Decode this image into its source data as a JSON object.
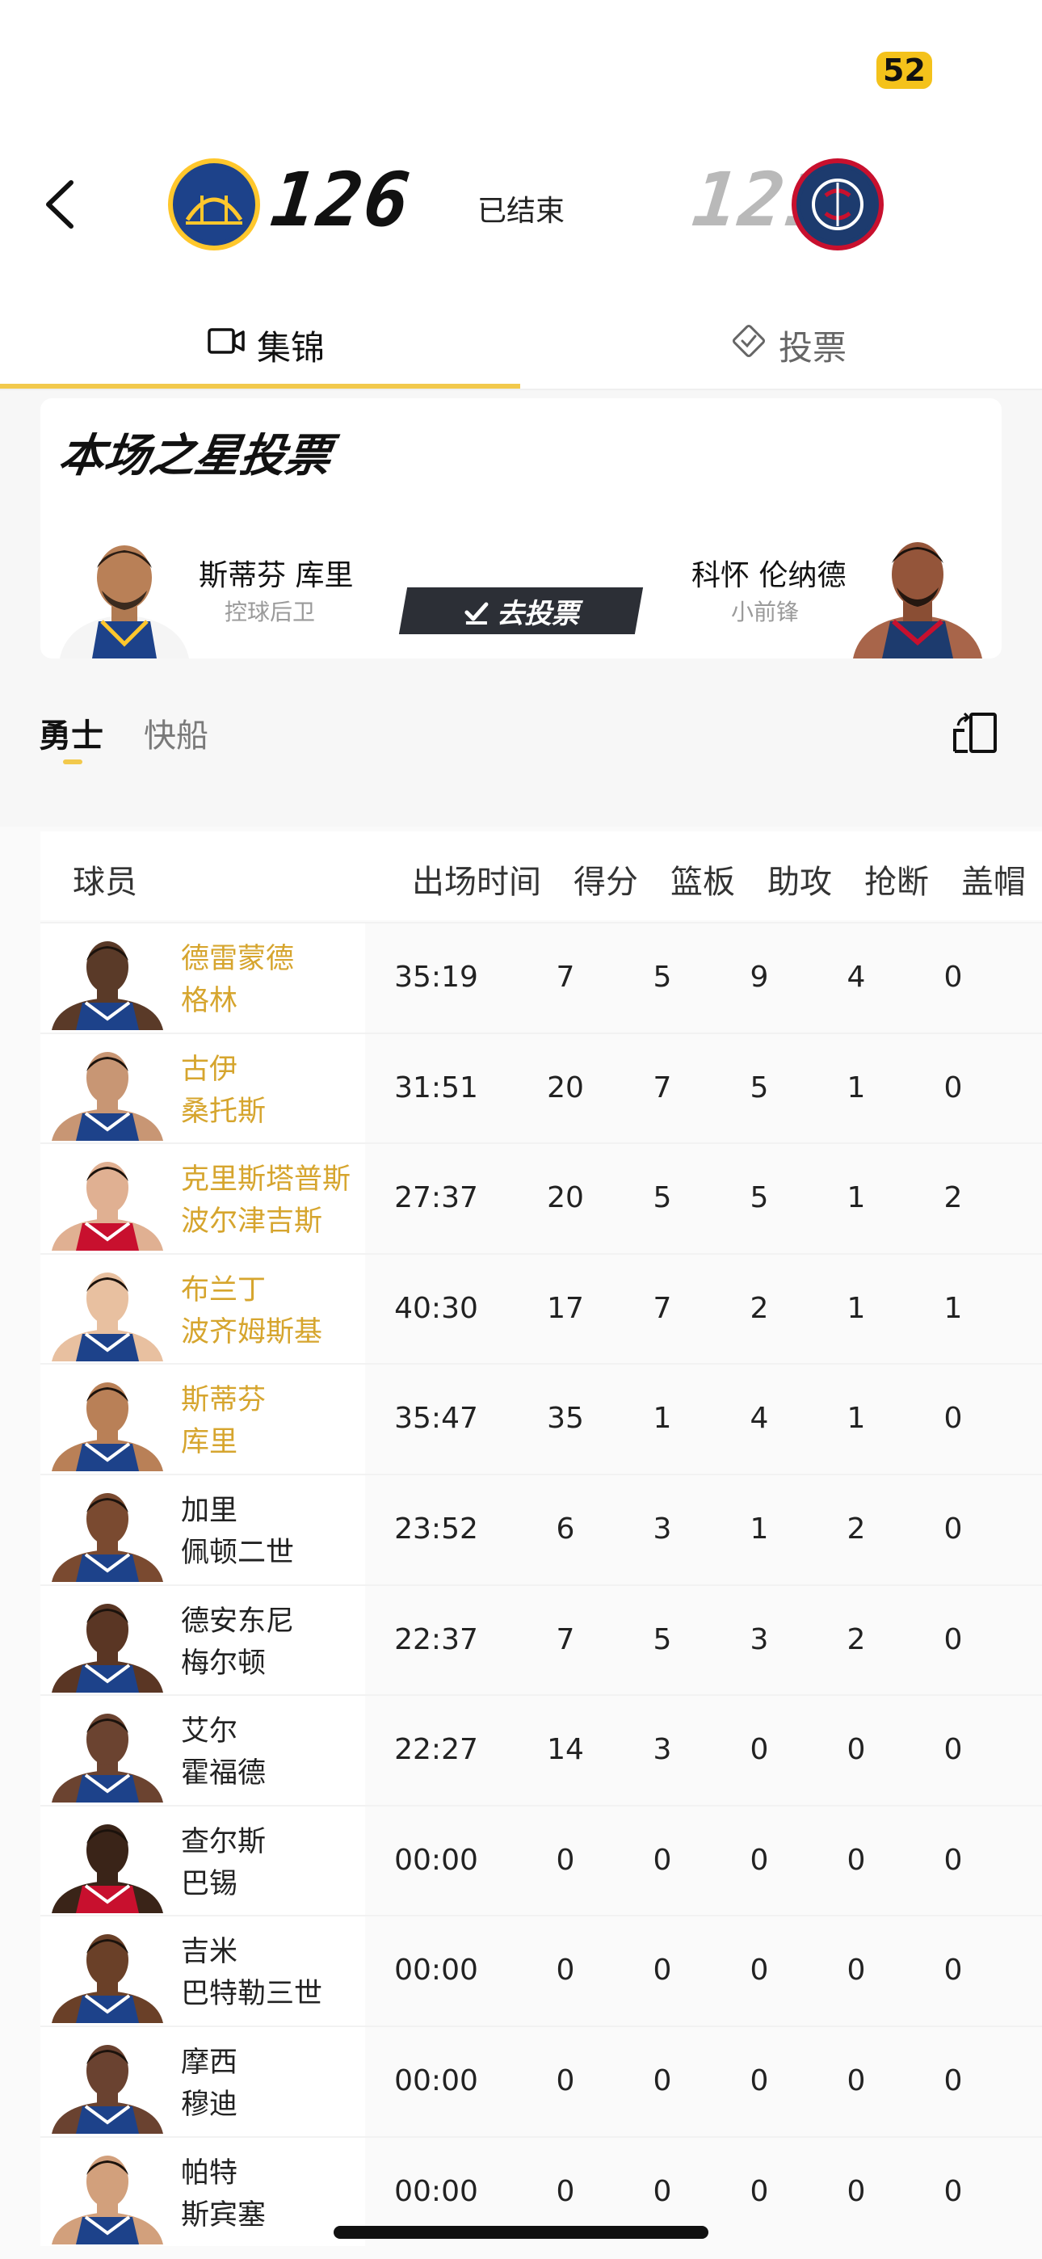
{
  "status_bar": {
    "badge": "52",
    "badge_color": "#f4c21b"
  },
  "game": {
    "home": {
      "score": "126",
      "logo_text": "GOLDEN STATE WARRIORS"
    },
    "away": {
      "score": "121",
      "logo_text": "LOS ANGELES CLIPPERS"
    },
    "status": "已结束"
  },
  "tabs": [
    {
      "label": "集锦",
      "icon": "video-icon",
      "active": true
    },
    {
      "label": "投票",
      "icon": "vote-check-icon",
      "active": false
    }
  ],
  "vote": {
    "title": "本场之星投票",
    "left": {
      "name": "斯蒂芬 库里",
      "position": "控球后卫"
    },
    "right": {
      "name": "科怀 伦纳德",
      "position": "小前锋"
    },
    "button_label": "去投票"
  },
  "team_tabs": {
    "home": "勇士",
    "away": "快船",
    "active": "home"
  },
  "table": {
    "headers": [
      "球员",
      "出场时间",
      "得分",
      "篮板",
      "助攻",
      "抢断",
      "盖帽"
    ],
    "rows": [
      {
        "name1": "德雷蒙德",
        "name2": "格林",
        "starter": true,
        "min": "35:19",
        "pts": "7",
        "reb": "5",
        "ast": "9",
        "stl": "4",
        "blk": "0"
      },
      {
        "name1": "古伊",
        "name2": "桑托斯",
        "starter": true,
        "min": "31:51",
        "pts": "20",
        "reb": "7",
        "ast": "5",
        "stl": "1",
        "blk": "0"
      },
      {
        "name1": "克里斯塔普斯",
        "name2": "波尔津吉斯",
        "starter": true,
        "min": "27:37",
        "pts": "20",
        "reb": "5",
        "ast": "5",
        "stl": "1",
        "blk": "2"
      },
      {
        "name1": "布兰丁",
        "name2": "波齐姆斯基",
        "starter": true,
        "min": "40:30",
        "pts": "17",
        "reb": "7",
        "ast": "2",
        "stl": "1",
        "blk": "1"
      },
      {
        "name1": "斯蒂芬",
        "name2": "库里",
        "starter": true,
        "min": "35:47",
        "pts": "35",
        "reb": "1",
        "ast": "4",
        "stl": "1",
        "blk": "0"
      },
      {
        "name1": "加里",
        "name2": "佩顿二世",
        "starter": false,
        "min": "23:52",
        "pts": "6",
        "reb": "3",
        "ast": "1",
        "stl": "2",
        "blk": "0"
      },
      {
        "name1": "德安东尼",
        "name2": "梅尔顿",
        "starter": false,
        "min": "22:37",
        "pts": "7",
        "reb": "5",
        "ast": "3",
        "stl": "2",
        "blk": "0"
      },
      {
        "name1": "艾尔",
        "name2": "霍福德",
        "starter": false,
        "min": "22:27",
        "pts": "14",
        "reb": "3",
        "ast": "0",
        "stl": "0",
        "blk": "0"
      },
      {
        "name1": "查尔斯",
        "name2": "巴锡",
        "starter": false,
        "min": "00:00",
        "pts": "0",
        "reb": "0",
        "ast": "0",
        "stl": "0",
        "blk": "0"
      },
      {
        "name1": "吉米",
        "name2": "巴特勒三世",
        "starter": false,
        "min": "00:00",
        "pts": "0",
        "reb": "0",
        "ast": "0",
        "stl": "0",
        "blk": "0"
      },
      {
        "name1": "摩西",
        "name2": "穆迪",
        "starter": false,
        "min": "00:00",
        "pts": "0",
        "reb": "0",
        "ast": "0",
        "stl": "0",
        "blk": "0"
      },
      {
        "name1": "帕特",
        "name2": "斯宾塞",
        "starter": false,
        "min": "00:00",
        "pts": "0",
        "reb": "0",
        "ast": "0",
        "stl": "0",
        "blk": "0"
      }
    ]
  },
  "colors": {
    "accent": "#f2c94c",
    "starter_name": "#d6a52e",
    "home_jersey": "#1d428a",
    "away_jersey": "#1d3b6e"
  }
}
